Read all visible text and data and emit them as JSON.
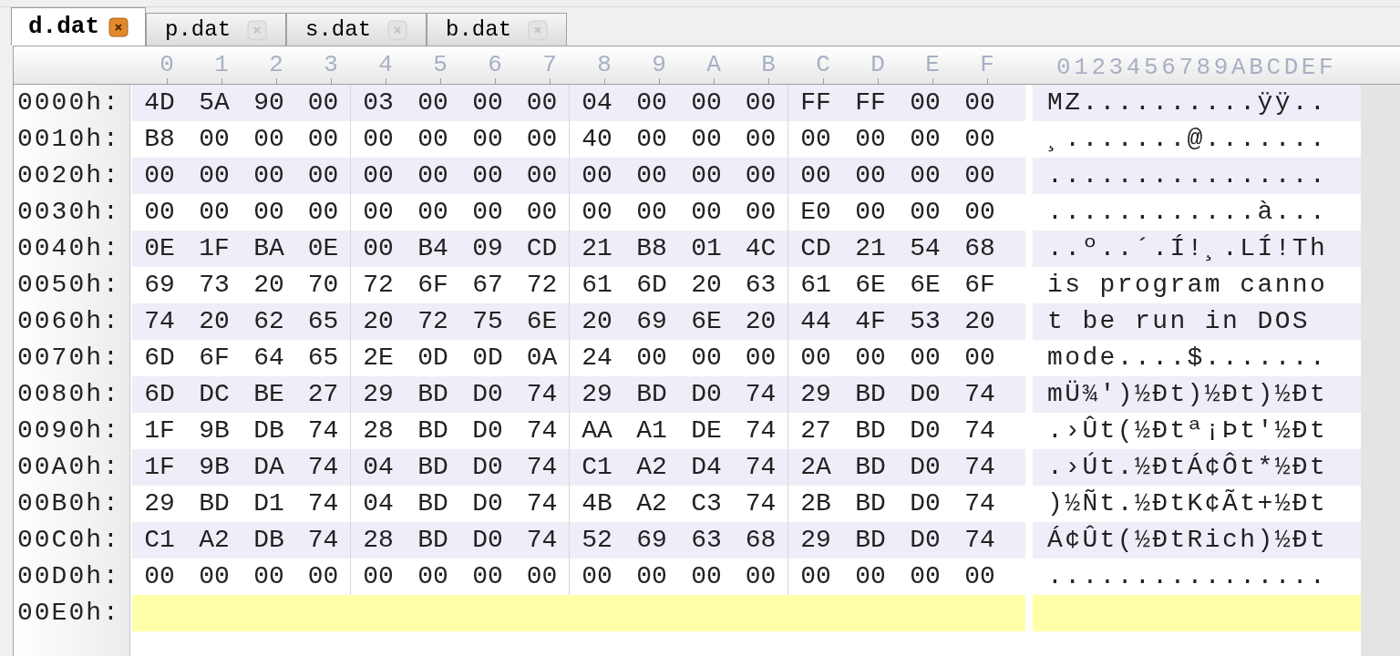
{
  "tabs": [
    {
      "label": "d.dat",
      "selected": true
    },
    {
      "label": "p.dat",
      "selected": false
    },
    {
      "label": "s.dat",
      "selected": false
    },
    {
      "label": "b.dat",
      "selected": false
    }
  ],
  "ruler": {
    "hex_columns": [
      "0",
      "1",
      "2",
      "3",
      "4",
      "5",
      "6",
      "7",
      "8",
      "9",
      "A",
      "B",
      "C",
      "D",
      "E",
      "F"
    ],
    "ascii_header": "0123456789ABCDEF"
  },
  "rows": [
    {
      "address": "0000h:",
      "bytes": [
        "4D",
        "5A",
        "90",
        "00",
        "03",
        "00",
        "00",
        "00",
        "04",
        "00",
        "00",
        "00",
        "FF",
        "FF",
        "00",
        "00"
      ],
      "ascii": "MZ..........ÿÿ..",
      "current": false
    },
    {
      "address": "0010h:",
      "bytes": [
        "B8",
        "00",
        "00",
        "00",
        "00",
        "00",
        "00",
        "00",
        "40",
        "00",
        "00",
        "00",
        "00",
        "00",
        "00",
        "00"
      ],
      "ascii": "¸.......@.......",
      "current": false
    },
    {
      "address": "0020h:",
      "bytes": [
        "00",
        "00",
        "00",
        "00",
        "00",
        "00",
        "00",
        "00",
        "00",
        "00",
        "00",
        "00",
        "00",
        "00",
        "00",
        "00"
      ],
      "ascii": "................",
      "current": false
    },
    {
      "address": "0030h:",
      "bytes": [
        "00",
        "00",
        "00",
        "00",
        "00",
        "00",
        "00",
        "00",
        "00",
        "00",
        "00",
        "00",
        "E0",
        "00",
        "00",
        "00"
      ],
      "ascii": "............à...",
      "current": false
    },
    {
      "address": "0040h:",
      "bytes": [
        "0E",
        "1F",
        "BA",
        "0E",
        "00",
        "B4",
        "09",
        "CD",
        "21",
        "B8",
        "01",
        "4C",
        "CD",
        "21",
        "54",
        "68"
      ],
      "ascii": "..º..´.Í!¸.LÍ!Th",
      "current": false
    },
    {
      "address": "0050h:",
      "bytes": [
        "69",
        "73",
        "20",
        "70",
        "72",
        "6F",
        "67",
        "72",
        "61",
        "6D",
        "20",
        "63",
        "61",
        "6E",
        "6E",
        "6F"
      ],
      "ascii": "is program canno",
      "current": false
    },
    {
      "address": "0060h:",
      "bytes": [
        "74",
        "20",
        "62",
        "65",
        "20",
        "72",
        "75",
        "6E",
        "20",
        "69",
        "6E",
        "20",
        "44",
        "4F",
        "53",
        "20"
      ],
      "ascii": "t be run in DOS ",
      "current": false
    },
    {
      "address": "0070h:",
      "bytes": [
        "6D",
        "6F",
        "64",
        "65",
        "2E",
        "0D",
        "0D",
        "0A",
        "24",
        "00",
        "00",
        "00",
        "00",
        "00",
        "00",
        "00"
      ],
      "ascii": "mode....$.......",
      "current": false
    },
    {
      "address": "0080h:",
      "bytes": [
        "6D",
        "DC",
        "BE",
        "27",
        "29",
        "BD",
        "D0",
        "74",
        "29",
        "BD",
        "D0",
        "74",
        "29",
        "BD",
        "D0",
        "74"
      ],
      "ascii": "mÜ¾')½Ðt)½Ðt)½Ðt",
      "current": false
    },
    {
      "address": "0090h:",
      "bytes": [
        "1F",
        "9B",
        "DB",
        "74",
        "28",
        "BD",
        "D0",
        "74",
        "AA",
        "A1",
        "DE",
        "74",
        "27",
        "BD",
        "D0",
        "74"
      ],
      "ascii": ".›Ût(½Ðtª¡Þt'½Ðt",
      "current": false
    },
    {
      "address": "00A0h:",
      "bytes": [
        "1F",
        "9B",
        "DA",
        "74",
        "04",
        "BD",
        "D0",
        "74",
        "C1",
        "A2",
        "D4",
        "74",
        "2A",
        "BD",
        "D0",
        "74"
      ],
      "ascii": ".›Út.½ÐtÁ¢Ôt*½Ðt",
      "current": false
    },
    {
      "address": "00B0h:",
      "bytes": [
        "29",
        "BD",
        "D1",
        "74",
        "04",
        "BD",
        "D0",
        "74",
        "4B",
        "A2",
        "C3",
        "74",
        "2B",
        "BD",
        "D0",
        "74"
      ],
      "ascii": ")½Ñt.½ÐtK¢Ãt+½Ðt",
      "current": false
    },
    {
      "address": "00C0h:",
      "bytes": [
        "C1",
        "A2",
        "DB",
        "74",
        "28",
        "BD",
        "D0",
        "74",
        "52",
        "69",
        "63",
        "68",
        "29",
        "BD",
        "D0",
        "74"
      ],
      "ascii": "Á¢Ût(½ÐtRich)½Ðt",
      "current": false
    },
    {
      "address": "00D0h:",
      "bytes": [
        "00",
        "00",
        "00",
        "00",
        "00",
        "00",
        "00",
        "00",
        "00",
        "00",
        "00",
        "00",
        "00",
        "00",
        "00",
        "00"
      ],
      "ascii": "................",
      "current": false
    },
    {
      "address": "00E0h:",
      "current": true
    }
  ]
}
